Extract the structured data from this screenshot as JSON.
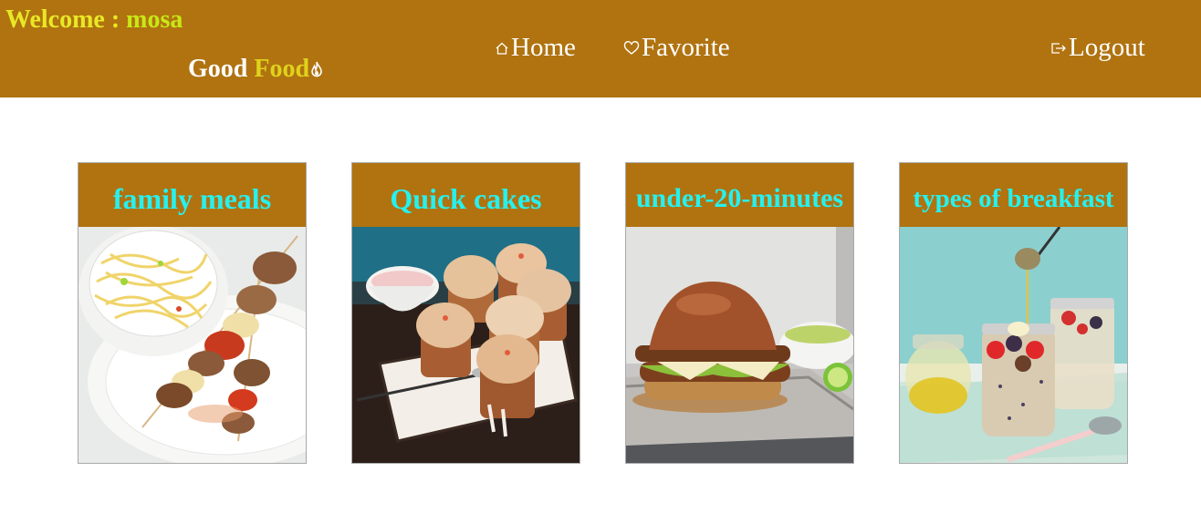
{
  "header": {
    "welcome_prefix": "Welcome : ",
    "username": "mosa",
    "brand_good": "Good ",
    "brand_food": "Food",
    "nav": {
      "home": "Home",
      "favorite": "Favorite",
      "logout": "Logout"
    }
  },
  "categories": [
    {
      "title": "family meals",
      "image": "pasta-and-kebab-skewers-photo"
    },
    {
      "title": "Quick cakes",
      "image": "muffins-on-tray-photo"
    },
    {
      "title": "under-20-minutes",
      "image": "burger-photo"
    },
    {
      "title": "types of breakfast",
      "image": "overnight-oats-jars-photo"
    }
  ],
  "colors": {
    "header_bg": "#b07310",
    "welcome_text": "#e8e825",
    "brand_food": "#e0d21c",
    "card_title": "#27f0ef"
  }
}
